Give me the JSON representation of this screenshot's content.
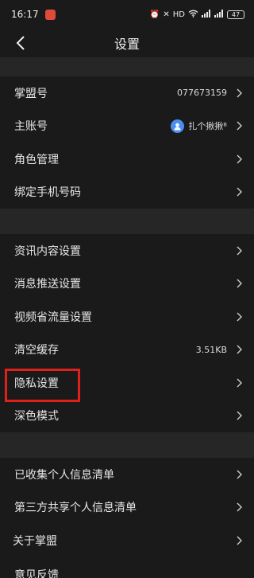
{
  "status_bar": {
    "time": "16:17",
    "battery": "47"
  },
  "nav": {
    "title": "设置"
  },
  "account": {
    "id_label": "掌盟号",
    "id_value": "077673159",
    "main_label": "主账号",
    "main_value": "扎个揪揪ᴮ",
    "roles_label": "角色管理",
    "phone_label": "绑定手机号码"
  },
  "settings": {
    "news_label": "资讯内容设置",
    "push_label": "消息推送设置",
    "video_label": "视频省流量设置",
    "cache_label": "清空缓存",
    "cache_value": "3.51KB",
    "privacy_label": "隐私设置",
    "dark_label": "深色模式"
  },
  "info": {
    "collected_label": "已收集个人信息清单",
    "third_party_label": "第三方共享个人信息清单",
    "about_label": "关于掌盟",
    "feedback_label": "意见反馈"
  },
  "colors": {
    "highlight": "#e0201a",
    "background": "#1a1a1a",
    "separator": "#262626"
  }
}
